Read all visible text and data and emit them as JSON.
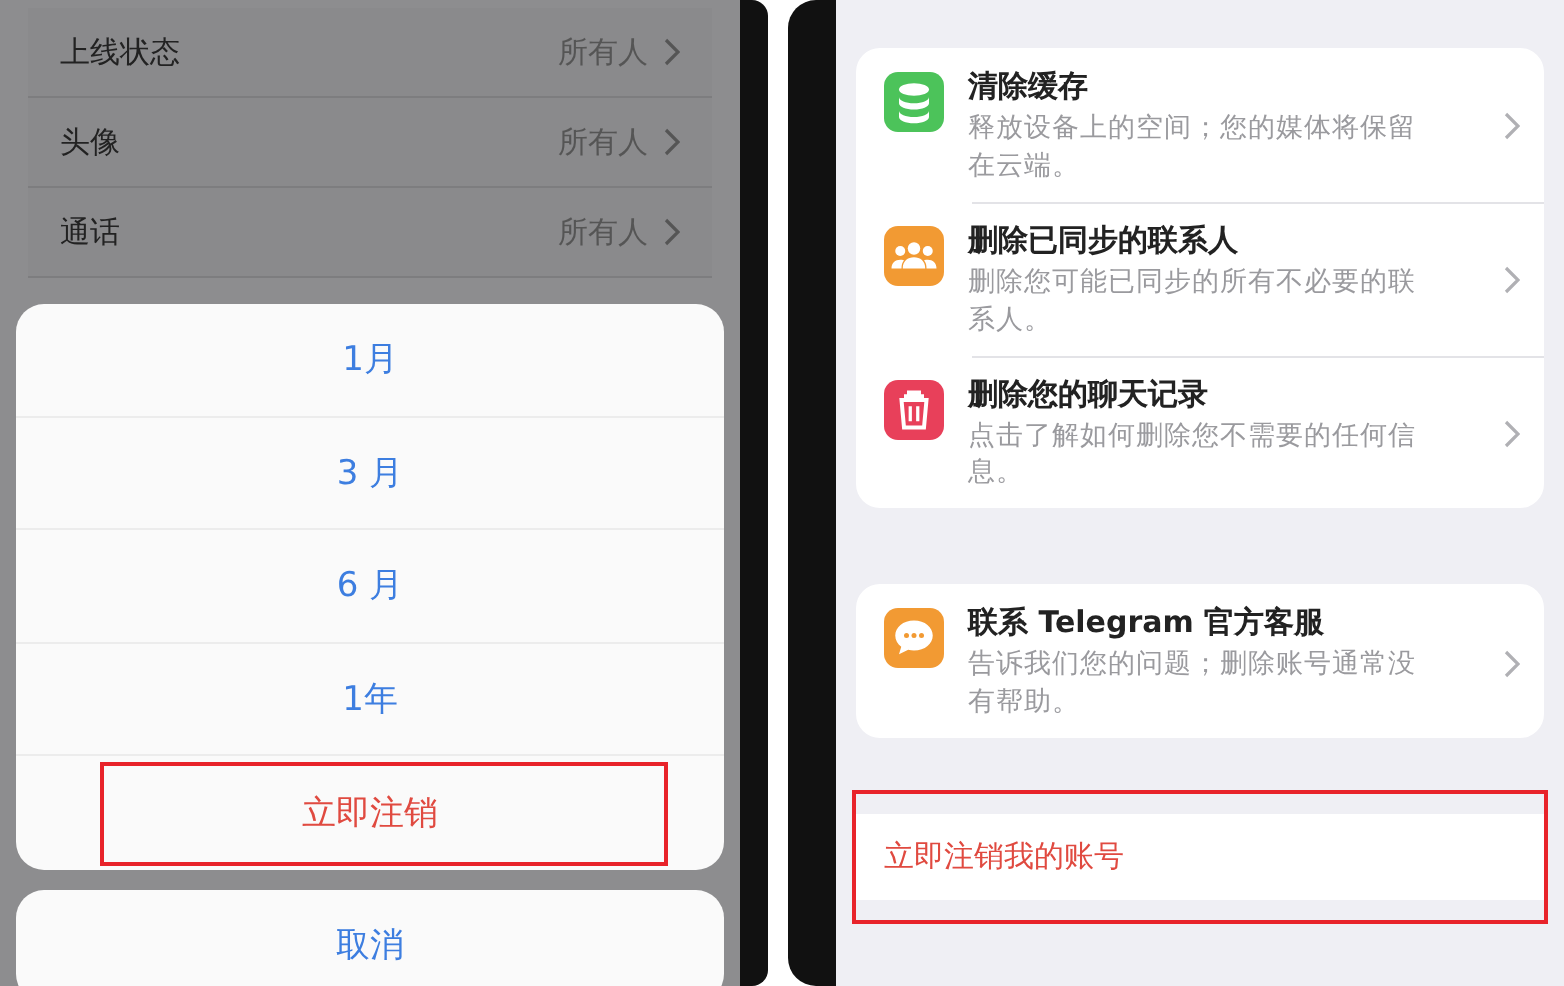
{
  "privacy_list": [
    {
      "label": "上线状态",
      "value": "所有人"
    },
    {
      "label": "头像",
      "value": "所有人"
    },
    {
      "label": "通话",
      "value": "所有人"
    }
  ],
  "action_sheet": {
    "options": [
      {
        "label": "1月",
        "highlighted": false
      },
      {
        "label": "3 月",
        "highlighted": false
      },
      {
        "label": "6 月",
        "highlighted": false
      },
      {
        "label": "1年",
        "highlighted": false
      },
      {
        "label": "立即注销",
        "kind": "destructive",
        "highlighted": true
      }
    ],
    "cancel": "取消"
  },
  "storage_options": [
    {
      "kind": "database",
      "color": "#4cc35a",
      "title": "清除缓存",
      "description": "释放设备上的空间；您的媒体将保留在云端。"
    },
    {
      "kind": "people",
      "color": "#f29a33",
      "title": "删除已同步的联系人",
      "description": "删除您可能已同步的所有不必要的联系人。"
    },
    {
      "kind": "trash",
      "color": "#e8405a",
      "title": "删除您的聊天记录",
      "description": "点击了解如何删除您不需要的任何信息。"
    }
  ],
  "support": {
    "kind": "chat",
    "color": "#f29a33",
    "title": "联系 Telegram 官方客服",
    "description": "告诉我们您的问题；删除账号通常没有帮助。"
  },
  "delete_account": {
    "label": "立即注销我的账号",
    "highlighted": true
  }
}
